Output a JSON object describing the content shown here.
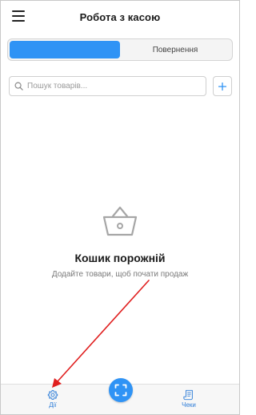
{
  "header": {
    "title": "Робота з касою",
    "menu_icon": "hamburger-icon"
  },
  "tabs": [
    {
      "label": "",
      "active": true
    },
    {
      "label": "Повернення",
      "active": false
    }
  ],
  "search": {
    "placeholder": "Пошук товарів...",
    "value": ""
  },
  "add_button": {
    "icon": "plus-icon"
  },
  "empty_state": {
    "icon": "basket-icon",
    "title": "Кошик порожній",
    "subtitle": "Додайте товари, щоб почати продаж"
  },
  "bottom_nav": {
    "actions_label": "Дії",
    "actions_icon": "gear-icon",
    "scan_icon": "scan-icon",
    "receipts_label": "Чеки",
    "receipts_icon": "receipt-icon"
  },
  "colors": {
    "accent": "#2f93f5",
    "arrow": "#e01e1e"
  }
}
